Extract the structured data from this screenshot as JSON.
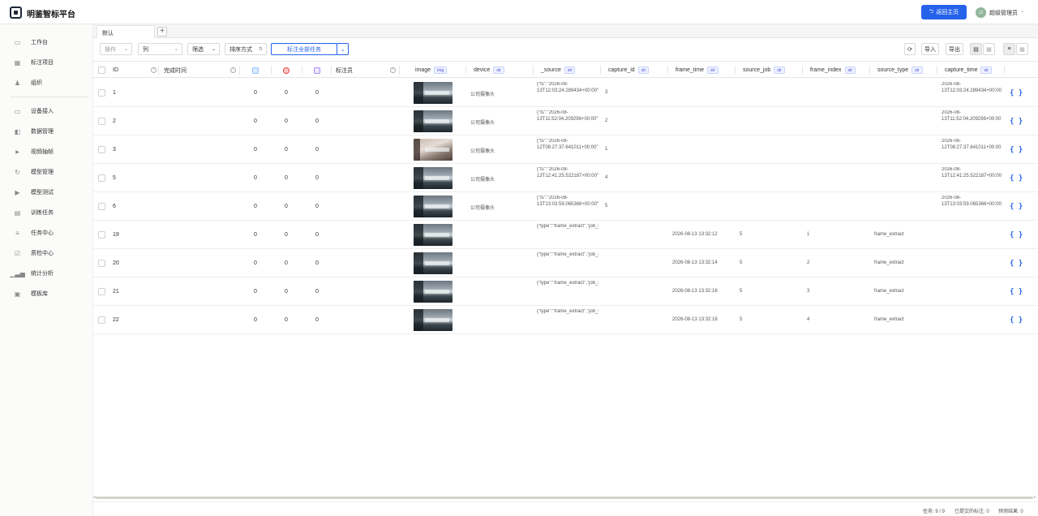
{
  "app": {
    "title": "明鉴智标平台"
  },
  "header": {
    "back_button": "返回主页",
    "avatar_text": "12",
    "user_name": "超级管理员"
  },
  "sidebar": {
    "items": [
      {
        "label": "工作台",
        "icon": "monitor-icon"
      },
      {
        "label": "标注项目",
        "icon": "grid-icon"
      },
      {
        "label": "组织",
        "icon": "org-icon"
      },
      {
        "label": "设备接入",
        "icon": "device-icon"
      },
      {
        "label": "数据管理",
        "icon": "database-icon"
      },
      {
        "label": "视频抽帧",
        "icon": "play-icon"
      },
      {
        "label": "模型管理",
        "icon": "model-icon"
      },
      {
        "label": "模型测试",
        "icon": "play-icon"
      },
      {
        "label": "训练任务",
        "icon": "document-icon"
      },
      {
        "label": "任务中心",
        "icon": "list-icon"
      },
      {
        "label": "质检中心",
        "icon": "check-icon"
      },
      {
        "label": "统计分析",
        "icon": "chart-icon"
      },
      {
        "label": "模板库",
        "icon": "template-icon"
      }
    ]
  },
  "tabs": [
    {
      "label": "默认"
    }
  ],
  "toolbar": {
    "actions": "操作",
    "columns": "列",
    "filter": "筛选",
    "sort": "排序方式",
    "label_all": "标注全部任务",
    "import": "导入",
    "export": "导出"
  },
  "table": {
    "columns": {
      "id": "ID",
      "completed_at": "完成时间",
      "annotator": "标注员",
      "image": "image",
      "image_type": "img",
      "device": "device",
      "device_type": "str",
      "source": "_source",
      "source_type_badge": "str",
      "capture_id": "capture_id",
      "capture_id_type": "str",
      "frame_time": "frame_time",
      "frame_time_type": "str",
      "source_job": "source_job",
      "source_job_type": "str",
      "frame_index": "frame_index",
      "frame_index_type": "str",
      "source_type": "source_type",
      "source_type_type": "str",
      "capture_time": "capture_time",
      "capture_time_type": "str"
    },
    "rows": [
      {
        "id": "1",
        "a": "0",
        "b": "0",
        "c": "0",
        "device": "公司摄像头",
        "source": "{\"ts\":\"2026-08-13T12:03:24.289434+00:00\",\"type\":\"capture\",\"device",
        "capture_id": "3",
        "frame_time": "",
        "source_job": "",
        "frame_index": "",
        "source_type": "",
        "capture_time": "2026-08-13T12:03:24.289434+00:00"
      },
      {
        "id": "2",
        "a": "0",
        "b": "0",
        "c": "0",
        "device": "公司摄像头",
        "source": "{\"ts\":\"2026-08-13T11:52:04.209296+00:00\",\"type\":\"capture\",\"device",
        "capture_id": "2",
        "frame_time": "",
        "source_job": "",
        "frame_index": "",
        "source_type": "",
        "capture_time": "2026-08-13T11:52:04.209296+00:00"
      },
      {
        "id": "3",
        "a": "0",
        "b": "0",
        "c": "0",
        "device": "公司摄像头",
        "source": "{\"ts\":\"2026-08-12T08:27:37.641011+00:00\",\"type\":\"capture\",\"device",
        "capture_id": "1",
        "frame_time": "",
        "source_job": "",
        "frame_index": "",
        "source_type": "",
        "capture_time": "2026-08-12T08:27:37.641011+00:00"
      },
      {
        "id": "5",
        "a": "0",
        "b": "0",
        "c": "0",
        "device": "公司摄像头",
        "source": "{\"ts\":\"2026-08-13T12:41:25.522187+00:00\",\"type\":\"capture\",\"device",
        "capture_id": "4",
        "frame_time": "",
        "source_job": "",
        "frame_index": "",
        "source_type": "",
        "capture_time": "2026-08-13T12:41:25.522187+00:00"
      },
      {
        "id": "6",
        "a": "0",
        "b": "0",
        "c": "0",
        "device": "公司摄像头",
        "source": "{\"ts\":\"2026-08-13T13:03:59.065366+00:00\",\"type\":\"capture\",\"device",
        "capture_id": "5",
        "frame_time": "",
        "source_job": "",
        "frame_index": "",
        "source_type": "",
        "capture_time": "2026-08-13T13:03:59.065366+00:00"
      },
      {
        "id": "19",
        "a": "0",
        "b": "0",
        "c": "0",
        "device": "",
        "source": "{\"type\":\"frame_extract\",\"job_id\":5,\"device_id\":1,\"recording_id\":8}",
        "capture_id": "",
        "frame_time": "2026-08-13 13:32:12",
        "source_job": "5",
        "frame_index": "1",
        "source_type": "frame_extract",
        "capture_time": ""
      },
      {
        "id": "20",
        "a": "0",
        "b": "0",
        "c": "0",
        "device": "",
        "source": "{\"type\":\"frame_extract\",\"job_id\":5,\"device_id\":1,\"recording_id\":8}",
        "capture_id": "",
        "frame_time": "2026-08-13 13:32:14",
        "source_job": "5",
        "frame_index": "2",
        "source_type": "frame_extract",
        "capture_time": ""
      },
      {
        "id": "21",
        "a": "0",
        "b": "0",
        "c": "0",
        "device": "",
        "source": "{\"type\":\"frame_extract\",\"job_id\":5,\"device_id\":1,\"recording_id\":8}",
        "capture_id": "",
        "frame_time": "2026-08-13 13:32:16",
        "source_job": "5",
        "frame_index": "3",
        "source_type": "frame_extract",
        "capture_time": ""
      },
      {
        "id": "22",
        "a": "0",
        "b": "0",
        "c": "0",
        "device": "",
        "source": "{\"type\":\"frame_extract\",\"job_id\":5,\"device_id\":1,\"recording_id\":8}",
        "capture_id": "",
        "frame_time": "2026-08-13 13:32:18",
        "source_job": "5",
        "frame_index": "4",
        "source_type": "frame_extract",
        "capture_time": ""
      }
    ],
    "json_icon": "{ }"
  },
  "status": {
    "tasks": "任务: 9 / 9",
    "submitted": "已提交的标注: 0",
    "predictions": "预测结果: 0"
  },
  "colors": {
    "primary": "#2563eb",
    "sidebar_bg": "#fbfbfa"
  }
}
